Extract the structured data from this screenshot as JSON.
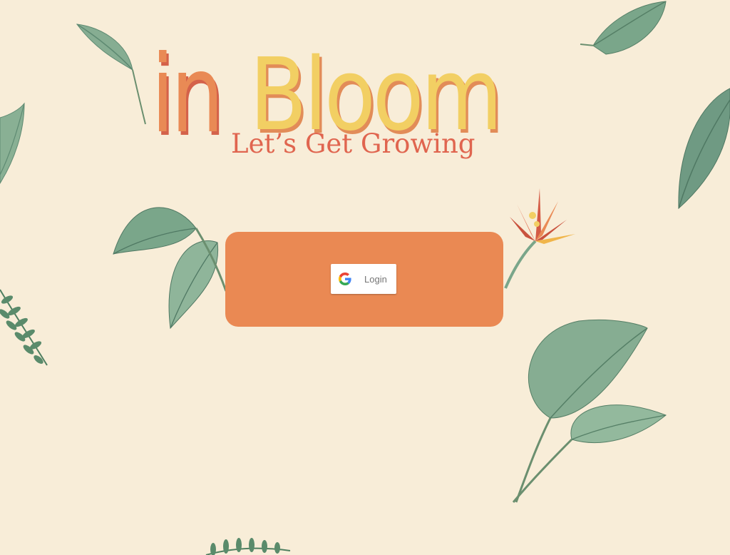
{
  "app": {
    "logo_part1": "in",
    "logo_part2": "Bloom",
    "tagline": "Let’s Get Growing"
  },
  "login": {
    "button_label": "Login",
    "icon": "google-g-icon"
  },
  "colors": {
    "background": "#f8edd8",
    "card": "#ea8953",
    "logo_orange": "#e98a55",
    "logo_yellow": "#f2cf63",
    "tagline": "#e0654f",
    "leaf_green": "#7aa68a"
  },
  "decorations": [
    "leaf-icon",
    "leaf-icon",
    "leaf-icon",
    "leaf-icon",
    "monstera-leaves-icon",
    "heliconia-flower-icon",
    "fern-sprig-icon",
    "hosta-leaves-icon",
    "fern-sprig-icon"
  ]
}
